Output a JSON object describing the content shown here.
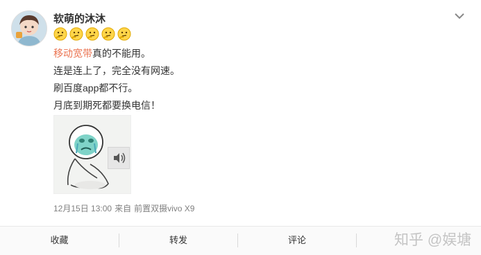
{
  "post": {
    "username": "软萌的沐沐",
    "emoji_icons": [
      "thinking-face-icon",
      "thinking-face-icon",
      "thinking-face-icon",
      "thinking-face-icon",
      "thinking-face-icon"
    ],
    "line1_link": "移动宽带",
    "line1_rest": "真的不能用。",
    "line2": "连是连上了，完全没有网速。",
    "line3": "刷百度app都不行。",
    "line4": "月底到期死都要换电信！",
    "date": "12月15日 13:00",
    "source_prefix": "来自",
    "source": "前置双摄vivo X9"
  },
  "actions": {
    "favorite": "收藏",
    "repost": "转发",
    "comment": "评论"
  },
  "watermark": "知乎 @娱塘",
  "colors": {
    "link": "#eb7350",
    "meta": "#808080"
  }
}
